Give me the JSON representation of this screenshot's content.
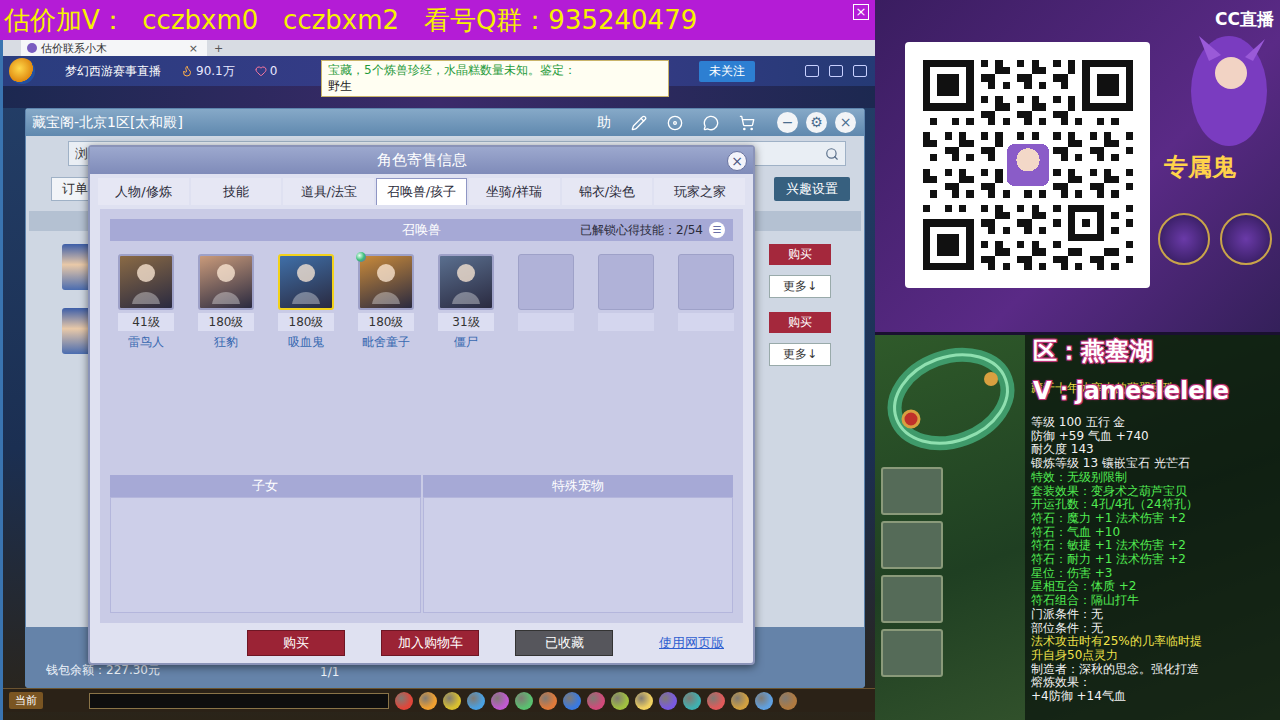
{
  "banner": {
    "text": "估价加V：  cczbxm0   cczbxm2   看号Q群：935240479",
    "close": "×"
  },
  "browser_tab": {
    "title": "估价联系小木",
    "close": "×",
    "add": "+"
  },
  "stream_bar": {
    "channel": "梦幻西游赛事直播",
    "viewers": "90.1万",
    "likes": "0",
    "notice": "宝藏，5个炼兽珍经，水晶糕数量未知。鉴定：",
    "notice_sub": "野生",
    "follow": "未关注"
  },
  "cbg_window": {
    "title": "藏宝阁-北京1区[太和殿]",
    "help": "助",
    "controls": [
      "−",
      "⚙",
      "×"
    ],
    "search_label": "浏",
    "order_tab": "订单",
    "interest_button": "兴趣设置",
    "rows": [
      {
        "buy": "购买",
        "more": "更多↓"
      },
      {
        "buy": "购买",
        "more": "更多↓"
      }
    ],
    "wallet": "钱包余额：227.30元",
    "page": "1/1"
  },
  "dialog": {
    "title": "角色寄售信息",
    "close": "×",
    "tabs": [
      {
        "label": "人物/修炼",
        "selected": false
      },
      {
        "label": "技能",
        "selected": false
      },
      {
        "label": "道具/法宝",
        "selected": false
      },
      {
        "label": "召唤兽/孩子",
        "selected": true
      },
      {
        "label": "坐骑/祥瑞",
        "selected": false
      },
      {
        "label": "锦衣/染色",
        "selected": false
      },
      {
        "label": "玩家之家",
        "selected": false
      }
    ],
    "pets_section": {
      "title": "召唤兽",
      "unlocked": "已解锁心得技能：2/54",
      "menu": "☰"
    },
    "pets": [
      {
        "kind": "pet",
        "level": "41级",
        "name": "雷鸟人",
        "selected": false,
        "gem": false,
        "color": "#8a6a45"
      },
      {
        "kind": "pet",
        "level": "180级",
        "name": "狂豹",
        "selected": false,
        "gem": false,
        "color": "#c99a7a"
      },
      {
        "kind": "pet",
        "level": "180级",
        "name": "吸血鬼",
        "selected": true,
        "gem": false,
        "color": "#3f6fa8"
      },
      {
        "kind": "pet",
        "level": "180级",
        "name": "毗舍童子",
        "selected": false,
        "gem": true,
        "color": "#c98a3a"
      },
      {
        "kind": "pet",
        "level": "31级",
        "name": "僵尸",
        "selected": false,
        "gem": false,
        "color": "#5a6f8f"
      },
      {
        "kind": "empty",
        "selected": false
      },
      {
        "kind": "empty",
        "selected": false
      },
      {
        "kind": "empty",
        "selected": false
      }
    ],
    "children_title": "子女",
    "special_title": "特殊宠物",
    "buttons": [
      {
        "label": "购买",
        "kind": "primary"
      },
      {
        "label": "加入购物车",
        "kind": "primary"
      },
      {
        "label": "已收藏",
        "kind": "muted"
      }
    ],
    "link": "使用网页版"
  },
  "taskbar": {
    "channel": "当前"
  },
  "qr_panel": {
    "brand": "CC直播",
    "promo": "专属鬼"
  },
  "item_view": {
    "overlay": [
      "区：燕塞湖",
      "V：jameslelele"
    ],
    "description": "藏于十年冰寒中的翡翠宝珠",
    "lines": [
      {
        "text": "等级 100  五行 金",
        "color": "#f2f2f2"
      },
      {
        "text": "防御 +59  气血 +740",
        "color": "#f2f2f2"
      },
      {
        "text": "耐久度 143",
        "color": "#f2f2f2"
      },
      {
        "text": "锻炼等级 13  镶嵌宝石 光芒石",
        "color": "#f2f2f2"
      },
      {
        "text": "特效：无级别限制",
        "color": "#52ee52"
      },
      {
        "text": "套装效果：变身术之葫芦宝贝",
        "color": "#52ee52"
      },
      {
        "text": "开运孔数：4孔/4孔（24符孔）",
        "color": "#52ee52"
      },
      {
        "text": "符石：魔力 +1 法术伤害 +2",
        "color": "#52ee52"
      },
      {
        "text": "符石：气血 +10",
        "color": "#52ee52"
      },
      {
        "text": "符石：敏捷 +1 法术伤害 +2",
        "color": "#52ee52"
      },
      {
        "text": "符石：耐力 +1 法术伤害 +2",
        "color": "#52ee52"
      },
      {
        "text": "星位：伤害 +3",
        "color": "#52ee52"
      },
      {
        "text": "星相互合：体质 +2",
        "color": "#52ee52"
      },
      {
        "text": "符石组合：隔山打牛",
        "color": "#52ee52"
      },
      {
        "text": "门派条件：无",
        "color": "#f2f2f2"
      },
      {
        "text": "部位条件：无",
        "color": "#f2f2f2"
      },
      {
        "text": "法术攻击时有25%的几率临时提",
        "color": "#f0e24a"
      },
      {
        "text": "升自身50点灵力",
        "color": "#f0e24a"
      },
      {
        "text": "制造者：深秋的思念。强化打造",
        "color": "#f2f2f2"
      },
      {
        "text": "熔炼效果：",
        "color": "#f2f2f2"
      },
      {
        "text": "+4防御 +14气血",
        "color": "#f2f2f2"
      }
    ]
  }
}
